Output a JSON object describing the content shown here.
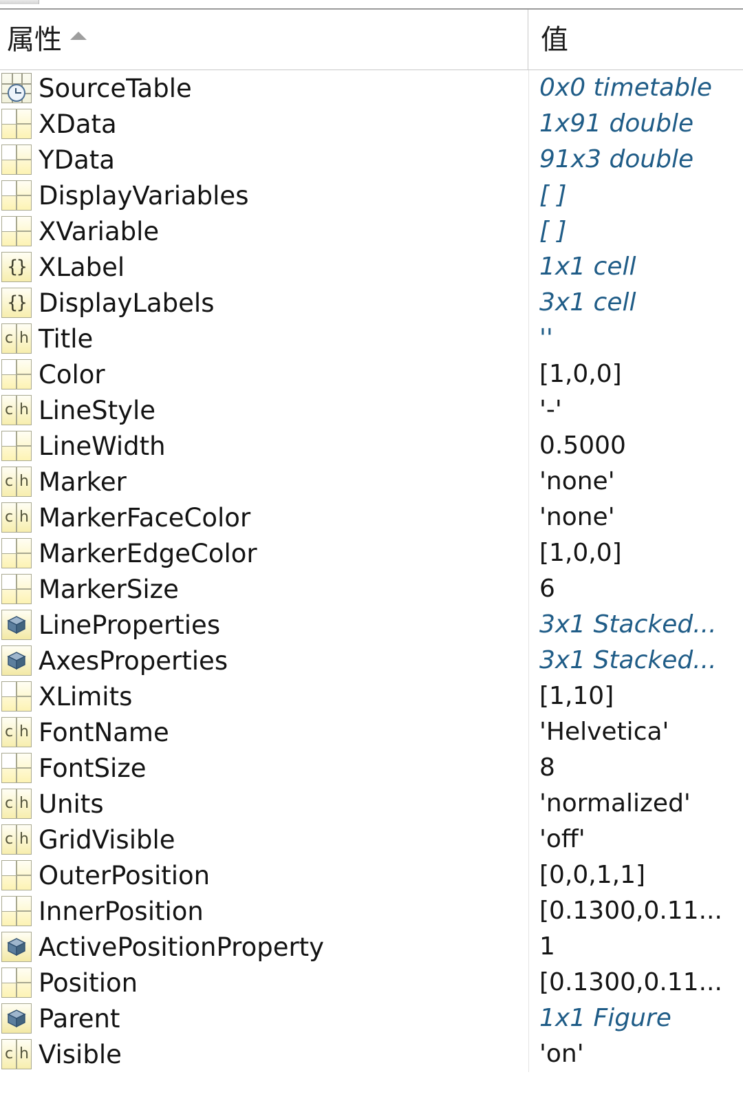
{
  "window": {
    "tab_strip_visible": true
  },
  "colors": {
    "object_value_text": "#1f5c87",
    "literal_value_text": "#141414",
    "property_text": "#131313",
    "header_text": "#1c1c1c",
    "grid_line": "#c8c8c8",
    "icon_yellow": "#f3e9a6",
    "icon_border": "#a8a890"
  },
  "header": {
    "property_column": "属性",
    "value_column": "值",
    "sort_indicator": "sort-ascending-icon"
  },
  "rows": [
    {
      "icon": "timetable-icon",
      "name": "SourceTable",
      "value": "0x0 timetable",
      "value_kind": "object"
    },
    {
      "icon": "array-icon",
      "name": "XData",
      "value": "1x91 double",
      "value_kind": "object"
    },
    {
      "icon": "array-icon",
      "name": "YData",
      "value": "91x3 double",
      "value_kind": "object"
    },
    {
      "icon": "array-icon",
      "name": "DisplayVariables",
      "value": "[ ]",
      "value_kind": "object"
    },
    {
      "icon": "array-icon",
      "name": "XVariable",
      "value": "[ ]",
      "value_kind": "object"
    },
    {
      "icon": "cell-icon",
      "name": "XLabel",
      "value": "1x1 cell",
      "value_kind": "object"
    },
    {
      "icon": "cell-icon",
      "name": "DisplayLabels",
      "value": "3x1 cell",
      "value_kind": "object"
    },
    {
      "icon": "char-icon",
      "name": "Title",
      "value": "''",
      "value_kind": "object"
    },
    {
      "icon": "array-icon",
      "name": "Color",
      "value": "[1,0,0]",
      "value_kind": "literal"
    },
    {
      "icon": "char-icon",
      "name": "LineStyle",
      "value": "'-'",
      "value_kind": "literal"
    },
    {
      "icon": "array-icon",
      "name": "LineWidth",
      "value": "0.5000",
      "value_kind": "literal"
    },
    {
      "icon": "char-icon",
      "name": "Marker",
      "value": "'none'",
      "value_kind": "literal"
    },
    {
      "icon": "char-icon",
      "name": "MarkerFaceColor",
      "value": "'none'",
      "value_kind": "literal"
    },
    {
      "icon": "array-icon",
      "name": "MarkerEdgeColor",
      "value": "[1,0,0]",
      "value_kind": "literal"
    },
    {
      "icon": "array-icon",
      "name": "MarkerSize",
      "value": "6",
      "value_kind": "literal"
    },
    {
      "icon": "object-icon",
      "name": "LineProperties",
      "value": "3x1 Stacked...",
      "value_kind": "object"
    },
    {
      "icon": "object-icon",
      "name": "AxesProperties",
      "value": "3x1 Stacked...",
      "value_kind": "object"
    },
    {
      "icon": "array-icon",
      "name": "XLimits",
      "value": "[1,10]",
      "value_kind": "literal"
    },
    {
      "icon": "char-icon",
      "name": "FontName",
      "value": "'Helvetica'",
      "value_kind": "literal"
    },
    {
      "icon": "array-icon",
      "name": "FontSize",
      "value": "8",
      "value_kind": "literal"
    },
    {
      "icon": "char-icon",
      "name": "Units",
      "value": "'normalized'",
      "value_kind": "literal"
    },
    {
      "icon": "char-icon",
      "name": "GridVisible",
      "value": "'off'",
      "value_kind": "literal"
    },
    {
      "icon": "array-icon",
      "name": "OuterPosition",
      "value": "[0,0,1,1]",
      "value_kind": "literal"
    },
    {
      "icon": "array-icon",
      "name": "InnerPosition",
      "value": "[0.1300,0.11...",
      "value_kind": "literal"
    },
    {
      "icon": "object-icon",
      "name": "ActivePositionProperty",
      "value": "1",
      "value_kind": "literal"
    },
    {
      "icon": "array-icon",
      "name": "Position",
      "value": "[0.1300,0.11...",
      "value_kind": "literal"
    },
    {
      "icon": "object-icon",
      "name": "Parent",
      "value": "1x1 Figure",
      "value_kind": "object"
    },
    {
      "icon": "char-icon",
      "name": "Visible",
      "value": "'on'",
      "value_kind": "literal"
    }
  ],
  "icon_glyphs": {
    "cell-icon": "{}",
    "char-icon_left": "c",
    "char-icon_right": "h"
  }
}
